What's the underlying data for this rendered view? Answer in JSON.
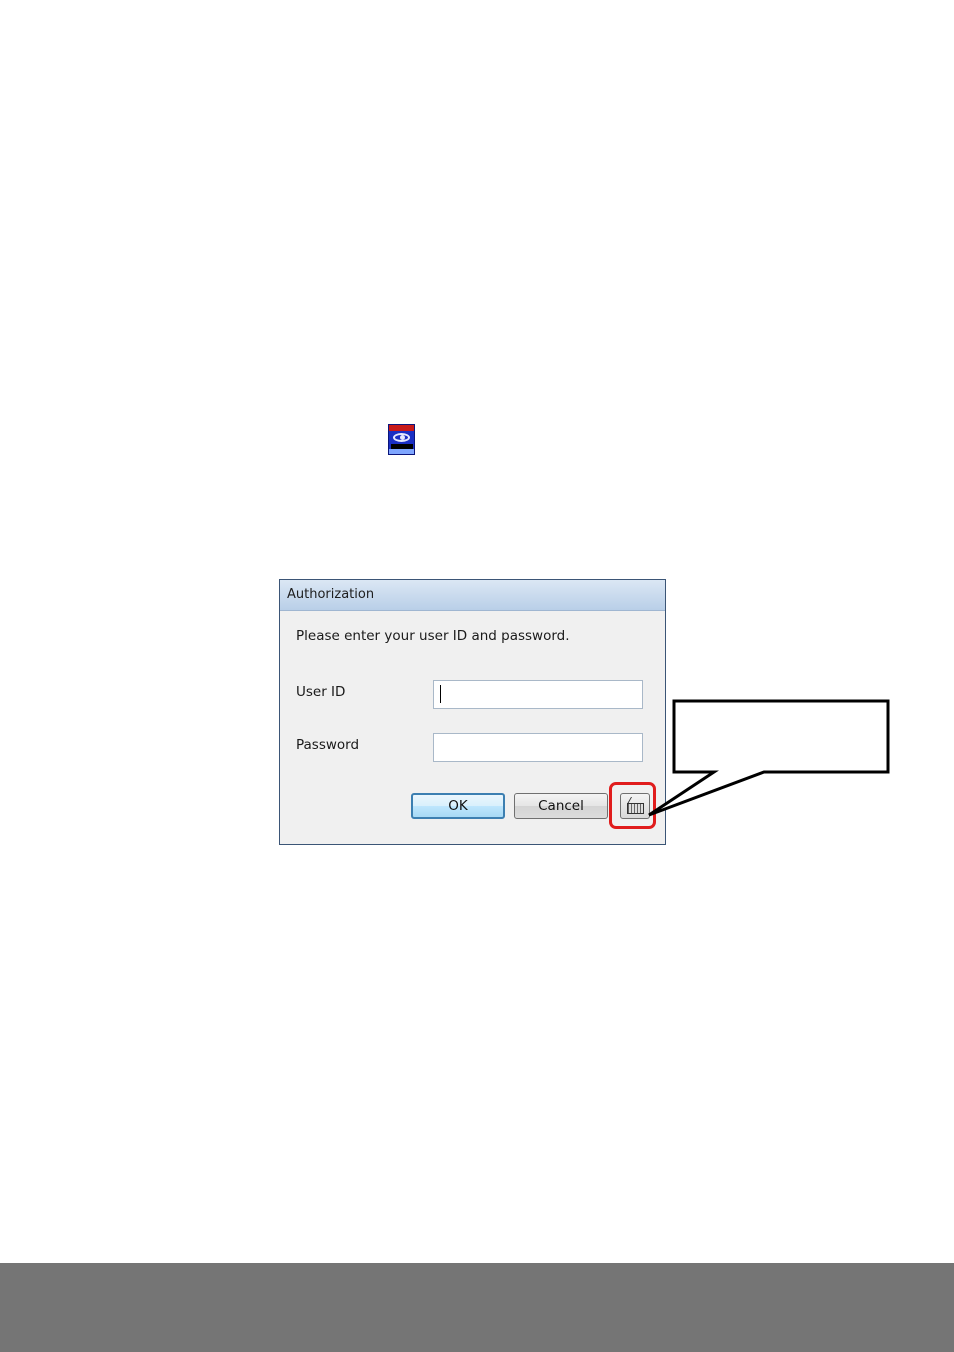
{
  "dialog": {
    "title": "Authorization",
    "prompt": "Please enter your user ID and password.",
    "user_id_label": "User ID",
    "user_id_value": "",
    "password_label": "Password",
    "password_value": "",
    "ok_label": "OK",
    "cancel_label": "Cancel"
  },
  "icons": {
    "app_icon": "application-shortcut-icon",
    "keyboard_icon": "virtual-keyboard-icon"
  },
  "colors": {
    "highlight": "#e01c1c",
    "footer": "#757575",
    "title_bar": "#c9dbef"
  }
}
